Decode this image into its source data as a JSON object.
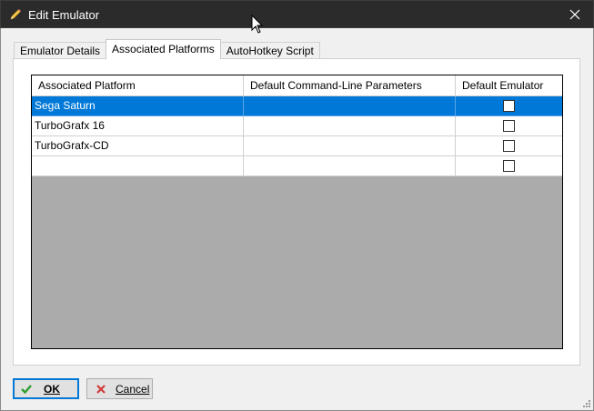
{
  "window": {
    "title": "Edit Emulator",
    "close_label": "✕"
  },
  "tabs": [
    {
      "label": "Emulator Details",
      "active": false
    },
    {
      "label": "Associated Platforms",
      "active": true
    },
    {
      "label": "AutoHotkey Script",
      "active": false
    }
  ],
  "grid": {
    "columns": [
      "Associated Platform",
      "Default Command-Line Parameters",
      "Default Emulator"
    ],
    "rows": [
      {
        "platform": "Sega Saturn",
        "params": "",
        "default": false,
        "selected": true
      },
      {
        "platform": "TurboGrafx 16",
        "params": "",
        "default": false,
        "selected": false
      },
      {
        "platform": "TurboGrafx-CD",
        "params": "",
        "default": false,
        "selected": false
      },
      {
        "platform": "",
        "params": "",
        "default": false,
        "selected": false
      }
    ]
  },
  "buttons": {
    "ok_label": "OK",
    "cancel_label": "Cancel"
  },
  "colors": {
    "selection": "#0078d7",
    "titlebar": "#2b2b2b",
    "grid_empty": "#ababab",
    "ok_check": "#2e9e2e",
    "cancel_x": "#d13a3a"
  },
  "icons": {
    "app": "pencil-icon",
    "close": "close-icon",
    "ok": "checkmark-icon",
    "cancel": "cancel-x-icon"
  }
}
